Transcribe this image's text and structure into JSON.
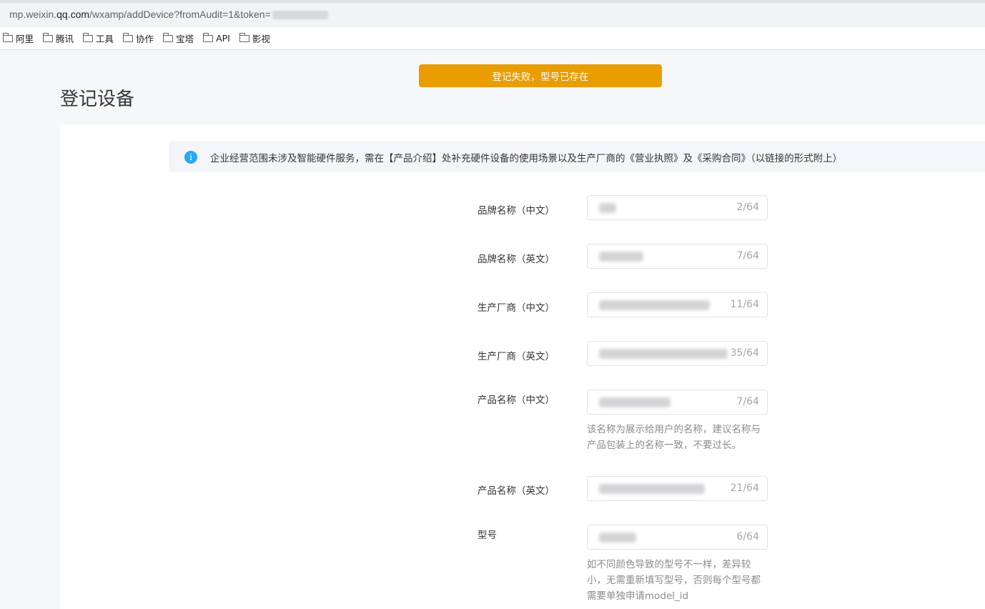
{
  "browser": {
    "url_host_prefix": "mp.weixin.",
    "url_host_main": "qq.com",
    "url_path": "/wxamp/addDevice?fromAudit=1&token=",
    "bookmarks": [
      "阿里",
      "腾讯",
      "工具",
      "协作",
      "宝塔",
      "API",
      "影视"
    ]
  },
  "toast": {
    "text": "登记失败，型号已存在",
    "color": "#e99d00"
  },
  "page": {
    "title": "登记设备"
  },
  "notice": {
    "text": "企业经营范围未涉及智能硬件服务，需在【产品介绍】处补充硬件设备的使用场景以及生产厂商的《营业执照》及《采购合同》（以链接的形式附上）",
    "icon": "info-icon"
  },
  "form": {
    "fields": [
      {
        "label": "品牌名称（中文）",
        "count": "2/64"
      },
      {
        "label": "品牌名称（英文）",
        "count": "7/64"
      },
      {
        "label": "生产厂商（中文）",
        "count": "11/64"
      },
      {
        "label": "生产厂商（英文）",
        "count": "35/64"
      },
      {
        "label": "产品名称（中文）",
        "count": "7/64",
        "hint": [
          "该名称为展示给用户的名称，建议名称与",
          "产品包装上的名称一致，不要过长。"
        ]
      },
      {
        "label": "产品名称（英文）",
        "count": "21/64"
      },
      {
        "label": "型号",
        "count": "6/64",
        "hint": [
          "如不同颜色导致的型号不一样，差异较",
          "小，无需重新填写型号，否则每个型号都",
          "需要单独申请model_id"
        ]
      }
    ]
  }
}
